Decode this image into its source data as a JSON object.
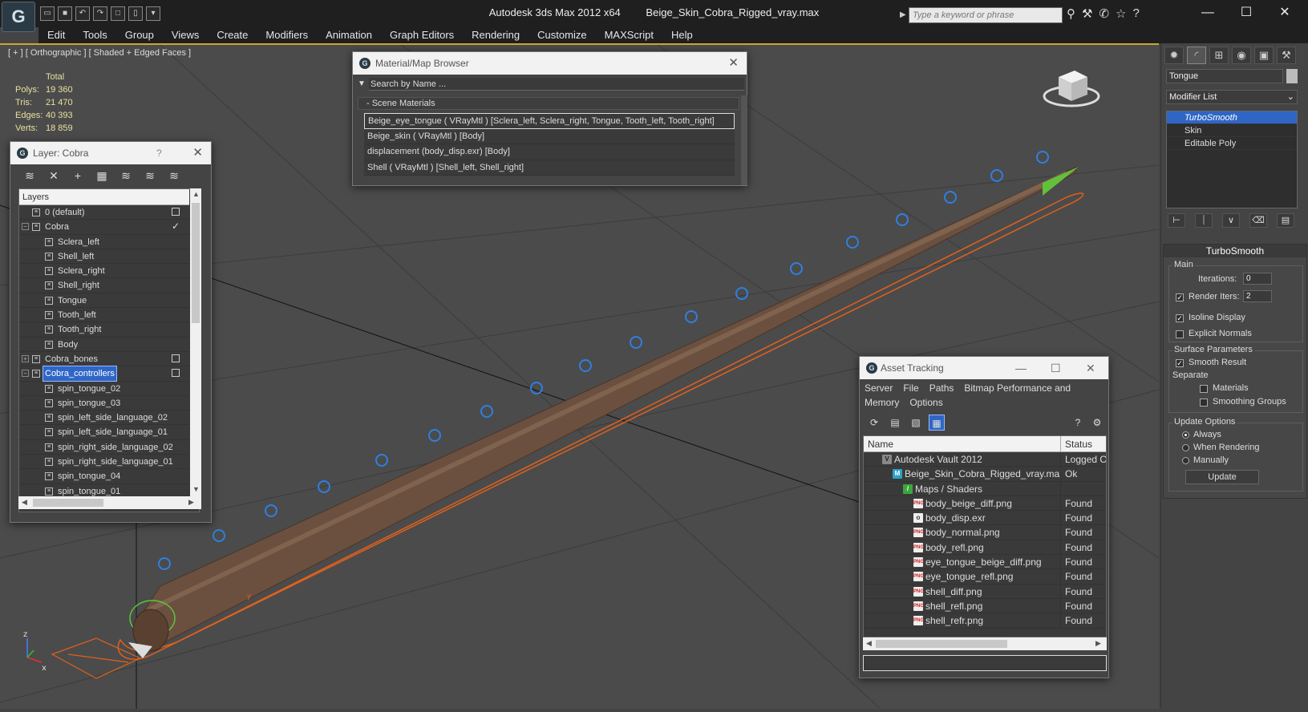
{
  "title": {
    "app": "Autodesk 3ds Max  2012 x64",
    "file": "Beige_Skin_Cobra_Rigged_vray.max",
    "search_placeholder": "Type a keyword or phrase"
  },
  "menu": [
    "Edit",
    "Tools",
    "Group",
    "Views",
    "Create",
    "Modifiers",
    "Animation",
    "Graph Editors",
    "Rendering",
    "Customize",
    "MAXScript",
    "Help"
  ],
  "viewport": {
    "label": "[ + ] [ Orthographic ] [ Shaded + Edged Faces ]",
    "stats_header": "Total",
    "stats": [
      {
        "k": "Polys:",
        "v": "19 360"
      },
      {
        "k": "Tris:",
        "v": "21 470"
      },
      {
        "k": "Edges:",
        "v": "40 393"
      },
      {
        "k": "Verts:",
        "v": "18 859"
      }
    ],
    "axis_x": "x",
    "axis_y": "y",
    "axis_z": "z"
  },
  "command_panel": {
    "object_name": "Tongue",
    "modifier_list": "Modifier List",
    "stack": [
      "TurboSmooth",
      "Skin",
      "Editable Poly"
    ],
    "rollout_title": "TurboSmooth",
    "main_label": "Main",
    "iterations_label": "Iterations:",
    "iterations_value": "0",
    "render_iters_label": "Render Iters:",
    "render_iters_value": "2",
    "isoline_label": "Isoline Display",
    "explicit_normals_label": "Explicit Normals",
    "surface_label": "Surface Parameters",
    "smooth_result_label": "Smooth Result",
    "separate_label": "Separate",
    "materials_label": "Materials",
    "smoothing_groups_label": "Smoothing Groups",
    "update_options_label": "Update Options",
    "always_label": "Always",
    "when_rendering_label": "When Rendering",
    "manually_label": "Manually",
    "update_button": "Update"
  },
  "layer_dialog": {
    "title": "Layer: Cobra",
    "help": "?",
    "header": "Layers",
    "rows": [
      {
        "name": "0 (default)",
        "child": false,
        "flag": "box",
        "exp": ""
      },
      {
        "name": "Cobra",
        "child": false,
        "flag": "check",
        "exp": "−"
      },
      {
        "name": "Sclera_left",
        "child": true,
        "flag": "",
        "exp": ""
      },
      {
        "name": "Shell_left",
        "child": true,
        "flag": "",
        "exp": ""
      },
      {
        "name": "Sclera_right",
        "child": true,
        "flag": "",
        "exp": ""
      },
      {
        "name": "Shell_right",
        "child": true,
        "flag": "",
        "exp": ""
      },
      {
        "name": "Tongue",
        "child": true,
        "flag": "",
        "exp": ""
      },
      {
        "name": "Tooth_left",
        "child": true,
        "flag": "",
        "exp": ""
      },
      {
        "name": "Tooth_right",
        "child": true,
        "flag": "",
        "exp": ""
      },
      {
        "name": "Body",
        "child": true,
        "flag": "",
        "exp": ""
      },
      {
        "name": "Cobra_bones",
        "child": false,
        "flag": "box",
        "exp": "+"
      },
      {
        "name": "Cobra_controllers",
        "child": false,
        "flag": "box",
        "exp": "−",
        "selected": true
      },
      {
        "name": "spin_tongue_02",
        "child": true,
        "flag": "",
        "exp": ""
      },
      {
        "name": "spin_tongue_03",
        "child": true,
        "flag": "",
        "exp": ""
      },
      {
        "name": "spin_left_side_language_02",
        "child": true,
        "flag": "",
        "exp": ""
      },
      {
        "name": "spin_left_side_language_01",
        "child": true,
        "flag": "",
        "exp": ""
      },
      {
        "name": "spin_right_side_language_02",
        "child": true,
        "flag": "",
        "exp": ""
      },
      {
        "name": "spin_right_side_language_01",
        "child": true,
        "flag": "",
        "exp": ""
      },
      {
        "name": "spin_tongue_04",
        "child": true,
        "flag": "",
        "exp": ""
      },
      {
        "name": "spin_tongue_01",
        "child": true,
        "flag": "",
        "exp": ""
      }
    ]
  },
  "material_browser": {
    "title": "Material/Map Browser",
    "search_placeholder": "Search by Name ...",
    "group": "- Scene Materials",
    "rows": [
      "Beige_eye_tongue  ( VRayMtl )  [Sclera_left, Sclera_right, Tongue, Tooth_left, Tooth_right]",
      "Beige_skin  ( VRayMtl )  [Body]",
      "displacement (body_disp.exr) [Body]",
      "Shell  ( VRayMtl )  [Shell_left, Shell_right]"
    ]
  },
  "asset_tracking": {
    "title": "Asset Tracking",
    "menu": [
      "Server",
      "File",
      "Paths",
      "Bitmap Performance and Memory",
      "Options"
    ],
    "col_name": "Name",
    "col_status": "Status",
    "rows": [
      {
        "name": "Autodesk Vault 2012",
        "status": "Logged Out",
        "indent": 1,
        "icon": "vault",
        "glyph": "V"
      },
      {
        "name": "Beige_Skin_Cobra_Rigged_vray.max",
        "status": "Ok",
        "indent": 2,
        "icon": "max",
        "glyph": "M"
      },
      {
        "name": "Maps / Shaders",
        "status": "",
        "indent": 3,
        "icon": "maps",
        "glyph": "/"
      },
      {
        "name": "body_beige_diff.png",
        "status": "Found",
        "indent": 4,
        "icon": "png",
        "glyph": "PNG"
      },
      {
        "name": "body_disp.exr",
        "status": "Found",
        "indent": 4,
        "icon": "exr",
        "glyph": "o"
      },
      {
        "name": "body_normal.png",
        "status": "Found",
        "indent": 4,
        "icon": "png",
        "glyph": "PNG"
      },
      {
        "name": "body_refl.png",
        "status": "Found",
        "indent": 4,
        "icon": "png",
        "glyph": "PNG"
      },
      {
        "name": "eye_tongue_beige_diff.png",
        "status": "Found",
        "indent": 4,
        "icon": "png",
        "glyph": "PNG"
      },
      {
        "name": "eye_tongue_refl.png",
        "status": "Found",
        "indent": 4,
        "icon": "png",
        "glyph": "PNG"
      },
      {
        "name": "shell_diff.png",
        "status": "Found",
        "indent": 4,
        "icon": "png",
        "glyph": "PNG"
      },
      {
        "name": "shell_refl.png",
        "status": "Found",
        "indent": 4,
        "icon": "png",
        "glyph": "PNG"
      },
      {
        "name": "shell_refr.png",
        "status": "Found",
        "indent": 4,
        "icon": "png",
        "glyph": "PNG"
      }
    ]
  },
  "colors": {
    "selection": "#2f66c6",
    "controller_circle": "#2f7fe0",
    "spline": "#e0601c",
    "body": "#6b5040",
    "stats_text": "#e8e0a0"
  }
}
